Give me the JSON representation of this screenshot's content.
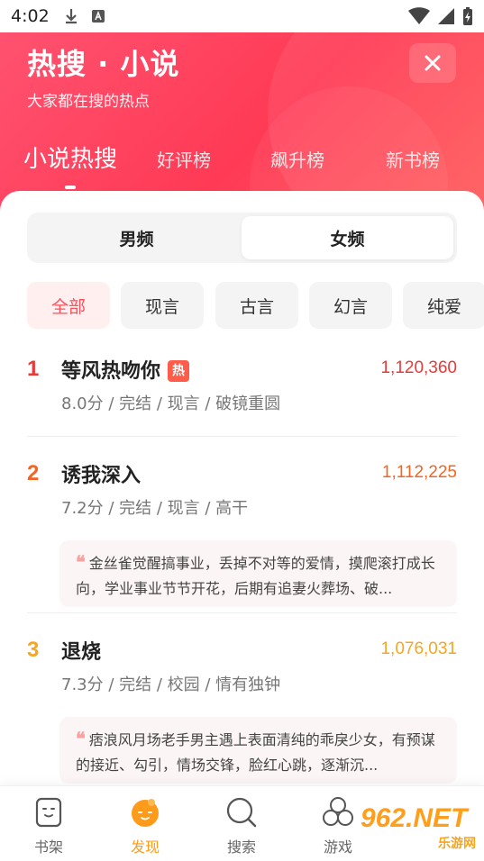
{
  "status_bar": {
    "time": "4:02"
  },
  "header": {
    "title": "热搜 · 小说",
    "subtitle": "大家都在搜的热点",
    "close_icon": "close-icon"
  },
  "tabs": [
    {
      "label": "小说热搜",
      "active": true
    },
    {
      "label": "好评榜",
      "active": false
    },
    {
      "label": "飙升榜",
      "active": false
    },
    {
      "label": "新书榜",
      "active": false
    }
  ],
  "segment": {
    "left": "男频",
    "right": "女频",
    "selected": "女频"
  },
  "categories": [
    {
      "label": "全部",
      "active": true
    },
    {
      "label": "现言",
      "active": false
    },
    {
      "label": "古言",
      "active": false
    },
    {
      "label": "幻言",
      "active": false
    },
    {
      "label": "纯爱",
      "active": false
    }
  ],
  "rankings": [
    {
      "rank": "1",
      "title": "等风热吻你",
      "badge": "热",
      "count": "1,120,360",
      "meta": "8.0分 / 完结 / 现言 / 破镜重圆",
      "rank_color": "#e83a3a",
      "count_color": "#e83a3a"
    },
    {
      "rank": "2",
      "title": "诱我深入",
      "count": "1,112,225",
      "meta": "7.2分 / 完结 / 现言 / 高干",
      "quote": "金丝雀觉醒搞事业，丢掉不对等的爱情，摸爬滚打成长向，学业事业节节开花，后期有追妻火葬场、破...",
      "rank_color": "#f26522",
      "count_color": "#f26522"
    },
    {
      "rank": "3",
      "title": "退烧",
      "count": "1,076,031",
      "meta": "7.3分 / 完结 / 校园 / 情有独钟",
      "quote": "痞浪风月场老手男主遇上表面清纯的乖戾少女，有预谋的接近、勾引，情场交锋，脸红心跳，逐渐沉...",
      "rank_color": "#f5a623",
      "count_color": "#f5a623"
    }
  ],
  "bottom_nav": [
    {
      "label": "书架",
      "icon": "bookshelf-icon",
      "active": false
    },
    {
      "label": "发现",
      "icon": "discover-icon",
      "active": true
    },
    {
      "label": "搜索",
      "icon": "search-icon",
      "active": false
    },
    {
      "label": "游戏",
      "icon": "game-icon",
      "active": false
    }
  ],
  "watermark": {
    "big": "962.NET",
    "small": "乐游网"
  },
  "colors": {
    "accent": "#ff3a55",
    "discover": "#ff9b1a"
  }
}
